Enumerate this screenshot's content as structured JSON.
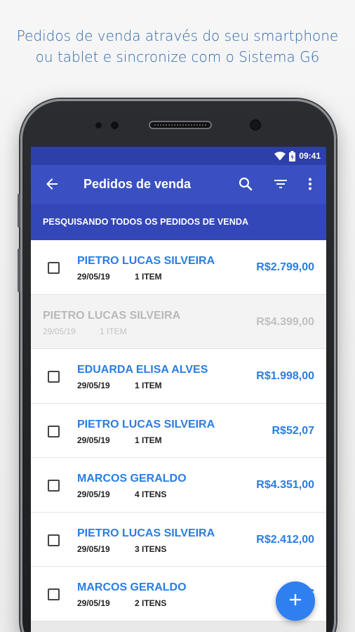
{
  "headline": {
    "line1": "Pedidos de venda através do seu smartphone",
    "line2": "ou tablet e sincronize com o Sistema G6"
  },
  "status_bar": {
    "time": "09:41",
    "icons": [
      "wifi-icon",
      "battery-icon"
    ]
  },
  "app_bar": {
    "title": "Pedidos de venda",
    "icons": [
      "back-arrow-icon",
      "search-icon",
      "filter-icon",
      "more-vert-icon"
    ]
  },
  "subheader": "PESQUISANDO TODOS OS PEDIDOS DE VENDA",
  "orders": [
    {
      "name": "PIETRO LUCAS SILVEIRA",
      "date": "29/05/19",
      "items": "1 ITEM",
      "total": "R$2.799,00",
      "disabled": false
    },
    {
      "name": "PIETRO LUCAS SILVEIRA",
      "date": "29/05/19",
      "items": "1 ITEM",
      "total": "R$4.399,00",
      "disabled": true
    },
    {
      "name": "EDUARDA ELISA ALVES",
      "date": "29/05/19",
      "items": "1 ITEM",
      "total": "R$1.998,00",
      "disabled": false
    },
    {
      "name": "PIETRO LUCAS SILVEIRA",
      "date": "29/05/19",
      "items": "1 ITEM",
      "total": "R$52,07",
      "disabled": false
    },
    {
      "name": "MARCOS GERALDO",
      "date": "29/05/19",
      "items": "4 ITENS",
      "total": "R$4.351,00",
      "disabled": false
    },
    {
      "name": "PIETRO LUCAS SILVEIRA",
      "date": "29/05/19",
      "items": "3 ITENS",
      "total": "R$2.412,00",
      "disabled": false
    },
    {
      "name": "MARCOS GERALDO",
      "date": "29/05/19",
      "items": "2 ITENS",
      "total": "R$",
      "disabled": false
    }
  ],
  "fab": {
    "icon": "plus-icon"
  },
  "colors": {
    "status_bar": "#2d3fa8",
    "app_bar": "#3a50c2",
    "subheader": "#3447b8",
    "accent_text": "#2a7de1",
    "fab": "#2f7ff0",
    "headline": "#2f67a8"
  }
}
